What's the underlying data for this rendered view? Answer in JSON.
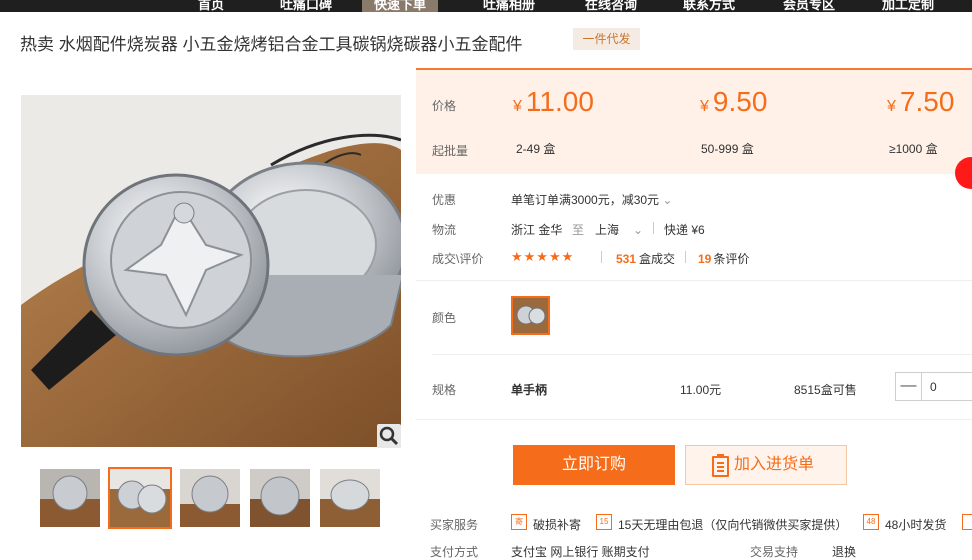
{
  "nav": {
    "items": [
      "首页",
      "吐痛口碑",
      "快速下单",
      "吐痛相册",
      "在线咨询",
      "联系方式",
      "会员专区",
      "加工定制"
    ]
  },
  "product": {
    "title": "热卖 水烟配件烧炭器 小五金烧烤铝合金工具碳锅烧碳器小五金配件",
    "badge": "一件代发"
  },
  "pricing": {
    "price_label": "价格",
    "moq_label": "起批量",
    "currency": "¥",
    "tiers": [
      {
        "price": "11.00",
        "range": "2-49 盒"
      },
      {
        "price": "9.50",
        "range": "50-999 盒"
      },
      {
        "price": "7.50",
        "range": "≥1000 盒"
      }
    ]
  },
  "promo": {
    "label": "优惠",
    "text": "单笔订单满3000元，减30元"
  },
  "logistics": {
    "label": "物流",
    "from": "浙江 金华",
    "to_word": "至",
    "to": "上海",
    "express": "快递 ¥6"
  },
  "deals": {
    "label": "成交\\评价",
    "stars": "★★★★★",
    "sold_count": "531",
    "sold_unit": "盒成交",
    "review_count": "19",
    "review_unit": "条评价"
  },
  "color": {
    "label": "颜色"
  },
  "spec": {
    "label": "规格",
    "name": "单手柄",
    "price": "11.00元",
    "stock": "8515盒可售",
    "qty_minus": "—",
    "qty_value": "0"
  },
  "actions": {
    "order": "立即订购",
    "cart": "加入进货单"
  },
  "services": {
    "label": "买家服务",
    "items": [
      {
        "icon": "寄",
        "text": "破损补寄"
      },
      {
        "icon": "15",
        "text": "15天无理由包退（仅向代销微供买家提供）"
      },
      {
        "icon": "48",
        "text": "48小时发货"
      }
    ]
  },
  "payment": {
    "label": "支付方式",
    "text": "支付宝  网上银行  账期支付",
    "trade_label": "交易支持",
    "trade_text": "退换"
  },
  "colors": {
    "accent": "#f56d1a",
    "price_bg": "#fff1e8",
    "nav_bg": "#1f1f1f"
  }
}
